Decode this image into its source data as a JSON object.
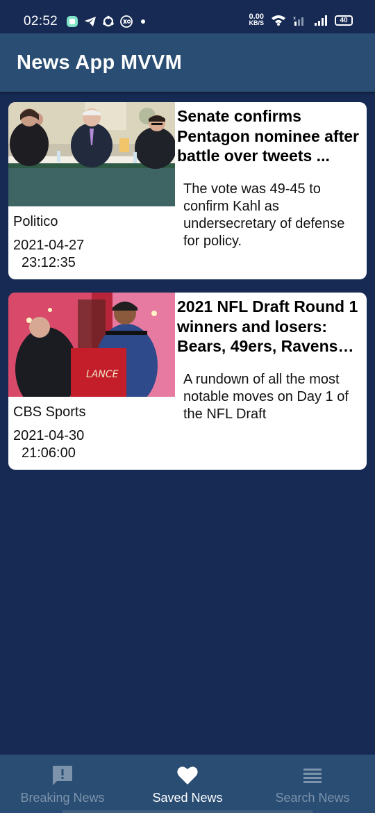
{
  "status_bar": {
    "time": "02:52",
    "speed_value": "0.00",
    "speed_unit": "KB/S",
    "battery": "40"
  },
  "app_bar": {
    "title": "News App MVVM"
  },
  "articles": [
    {
      "title": "Senate confirms Pentagon nominee after battle over tweets ...",
      "description": "The vote was 49-45 to confirm Kahl as undersecretary of defense for policy.",
      "source": "Politico",
      "date": "2021-04-27",
      "time": "23:12:35"
    },
    {
      "title": "2021 NFL Draft Round 1 winners and losers: Bears, 49ers, Ravens lo...",
      "description": "A rundown of all the most notable moves on Day 1 of the NFL Draft",
      "source": "CBS Sports",
      "date": "2021-04-30",
      "time": "21:06:00"
    }
  ],
  "bottom_nav": {
    "items": [
      {
        "label": "Breaking News",
        "icon": "feedback-icon"
      },
      {
        "label": "Saved News",
        "icon": "heart-icon"
      },
      {
        "label": "Search News",
        "icon": "list-icon"
      }
    ],
    "active": "Saved News"
  },
  "colors": {
    "background": "#162a54",
    "app_bar": "#294d73",
    "nav_inactive": "#7d93ab",
    "card": "#ffffff"
  }
}
